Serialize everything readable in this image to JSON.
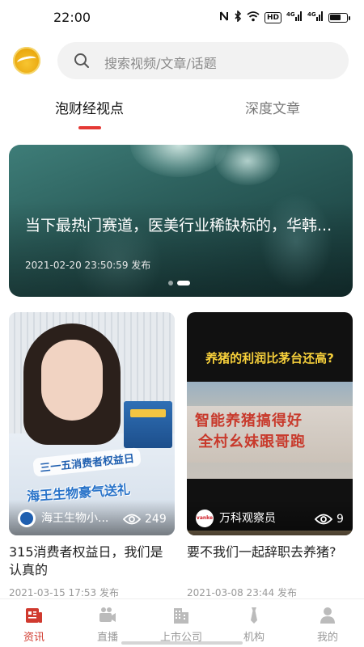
{
  "status_bar": {
    "time": "22:00",
    "icons": [
      "nfc-icon",
      "bluetooth-icon",
      "wifi-icon",
      "hd-icon",
      "signal-4g-icon",
      "signal-4g-icon",
      "battery-icon"
    ],
    "hd_label": "HD",
    "net1_label": "4G",
    "net2_label": "4G",
    "battery_level": 0.7
  },
  "header": {
    "logo_icon": "app-logo-icon",
    "search": {
      "placeholder": "搜索视频/文章/话题",
      "icon": "search-icon"
    }
  },
  "tabs": [
    {
      "label": "泡财经视点",
      "active": true
    },
    {
      "label": "深度文章",
      "active": false
    }
  ],
  "banner": {
    "title": "当下最热门赛道，医美行业稀缺标的，华韩...",
    "date": "2021-02-20 23:50:59 发布",
    "slides": 2,
    "active_slide": 2
  },
  "cards": [
    {
      "author": "海王生物小...",
      "views": "249",
      "title": "315消费者权益日，我们是认真的",
      "date": "2021-03-15 17:53 发布",
      "thumb_caption_1": "三一五消费者权益日",
      "thumb_caption_2": "海王生物豪气送礼",
      "avatar_icon": "haiwang-avatar-icon"
    },
    {
      "author": "万科观察员",
      "views": "9",
      "title": "要不我们一起辞职去养猪?",
      "date": "2021-03-08 23:44 发布",
      "thumb_headline": "养猪的利润比茅台还高?",
      "thumb_slogan_1": "智能养猪搞得好",
      "thumb_slogan_2": "全村幺妹跟哥跑",
      "avatar_text": "vanke",
      "avatar_icon": "vanke-avatar-icon"
    }
  ],
  "bottom_nav": [
    {
      "label": "资讯",
      "icon": "news-icon",
      "active": true
    },
    {
      "label": "直播",
      "icon": "video-camera-icon",
      "active": false
    },
    {
      "label": "上市公司",
      "icon": "building-icon",
      "active": false
    },
    {
      "label": "机构",
      "icon": "tie-icon",
      "active": false
    },
    {
      "label": "我的",
      "icon": "person-icon",
      "active": false
    }
  ],
  "colors": {
    "accent": "#e53935",
    "nav_active": "#d03a2f",
    "nav_inactive": "#999999",
    "search_bg": "#f2f2f2"
  }
}
